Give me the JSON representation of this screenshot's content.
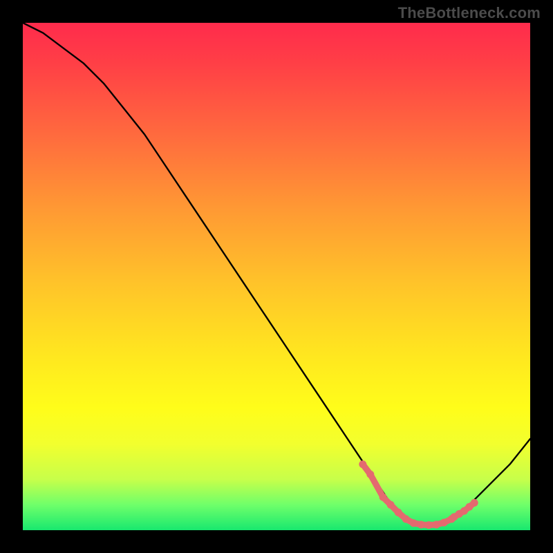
{
  "watermark": "TheBottleneck.com",
  "colors": {
    "frame": "#000000",
    "gradient_top": "#ff2b4c",
    "gradient_bottom": "#18e86f",
    "curve": "#000000",
    "markers": "#e46a6f"
  },
  "chart_data": {
    "type": "line",
    "title": "",
    "xlabel": "",
    "ylabel": "",
    "xlim": [
      0,
      100
    ],
    "ylim": [
      0,
      100
    ],
    "grid": false,
    "legend": false,
    "note": "No axis ticks or numeric labels are visible; x and y are normalized 0–100. y is bottleneck severity (higher = worse, red at top). Curve has a minimum near x≈78.",
    "series": [
      {
        "name": "bottleneck-curve",
        "x": [
          0,
          4,
          8,
          12,
          16,
          20,
          24,
          28,
          32,
          36,
          40,
          44,
          48,
          52,
          56,
          60,
          64,
          68,
          70,
          72,
          74,
          76,
          78,
          80,
          82,
          84,
          86,
          88,
          92,
          96,
          100
        ],
        "y": [
          100,
          98,
          95,
          92,
          88,
          83,
          78,
          72,
          66,
          60,
          54,
          48,
          42,
          36,
          30,
          24,
          18,
          12,
          9,
          6,
          3,
          1.5,
          1,
          1,
          1.2,
          1.8,
          3,
          5,
          9,
          13,
          18
        ]
      }
    ],
    "markers": {
      "name": "highlight-dots",
      "x": [
        67,
        68.5,
        71,
        72.5,
        74,
        75.5,
        77,
        78.5,
        80,
        81.5,
        83,
        84.5,
        85,
        86,
        87,
        88,
        89
      ],
      "y": [
        13,
        11,
        6.5,
        5,
        3.5,
        2.2,
        1.4,
        1.1,
        1.0,
        1.1,
        1.5,
        2.2,
        2.6,
        3.2,
        3.8,
        4.6,
        5.4
      ]
    }
  }
}
